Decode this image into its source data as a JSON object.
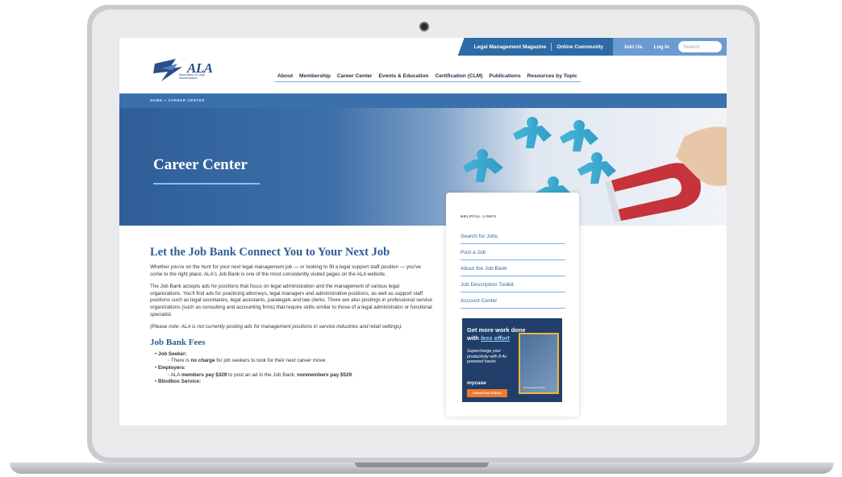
{
  "utility": {
    "links": [
      "Legal Management Magazine",
      "Online Community"
    ],
    "join": "Join Us",
    "login": "Log In",
    "search_placeholder": "Search"
  },
  "logo": {
    "name": "ALA",
    "subtitle": "Association of Legal Administrators"
  },
  "nav": [
    "About",
    "Membership",
    "Career Center",
    "Events & Education",
    "Certification (CLM)",
    "Publications",
    "Resources by Topic"
  ],
  "breadcrumb": "HOME > CAREER CENTER",
  "hero": {
    "title": "Career Center"
  },
  "helpful": {
    "title": "HELPFUL LINKS",
    "links": [
      "Search for Jobs",
      "Post a Job",
      "About the Job Bank",
      "Job Description Toolkit",
      "Account Center"
    ]
  },
  "ad": {
    "title_a": "Get more work done with ",
    "title_b": "less effort",
    "subtitle": "Supercharge your productivity with 8 AI-powered hacks.",
    "brand": "mycase",
    "button": "Unlock Free E-Book",
    "image_label": "8 AI-powered Hacks"
  },
  "main": {
    "heading": "Let the Job Bank Connect You to Your Next Job",
    "p1": "Whether you're on the hunt for your next legal management job — or looking to fill a legal support staff position — you've come to the right place. ALA's Job Bank is one of the most consistently visited pages on the ALA website.",
    "p2": "The Job Bank accepts ads for positions that focus on legal administration and the management of various legal organizations. You'll find ads for practicing attorneys, legal managers and administrative positions, as well as support staff positions such as legal secretaries, legal assistants, paralegals and law clerks. There are also postings in professional service organizations (such as consulting and accounting firms) that require skills similar to those of a legal administrator or functional specialist.",
    "p3": "(Please note: ALA is not currently posting ads for management positions in service industries and retail settings).",
    "fees_heading": "Job Bank Fees",
    "fees": {
      "seeker_label": "Job Seeker:",
      "seeker_a": "There is ",
      "seeker_b": "no charge",
      "seeker_c": " for job seekers to look for their next career move.",
      "employer_label": "Employers:",
      "employer_a": "ALA ",
      "employer_b": "members pay $329",
      "employer_c": " to post an ad in the Job Bank; ",
      "employer_d": "nonmembers pay $529",
      "employer_e": ".",
      "blindbox_label": "Blindbox Service:"
    }
  }
}
